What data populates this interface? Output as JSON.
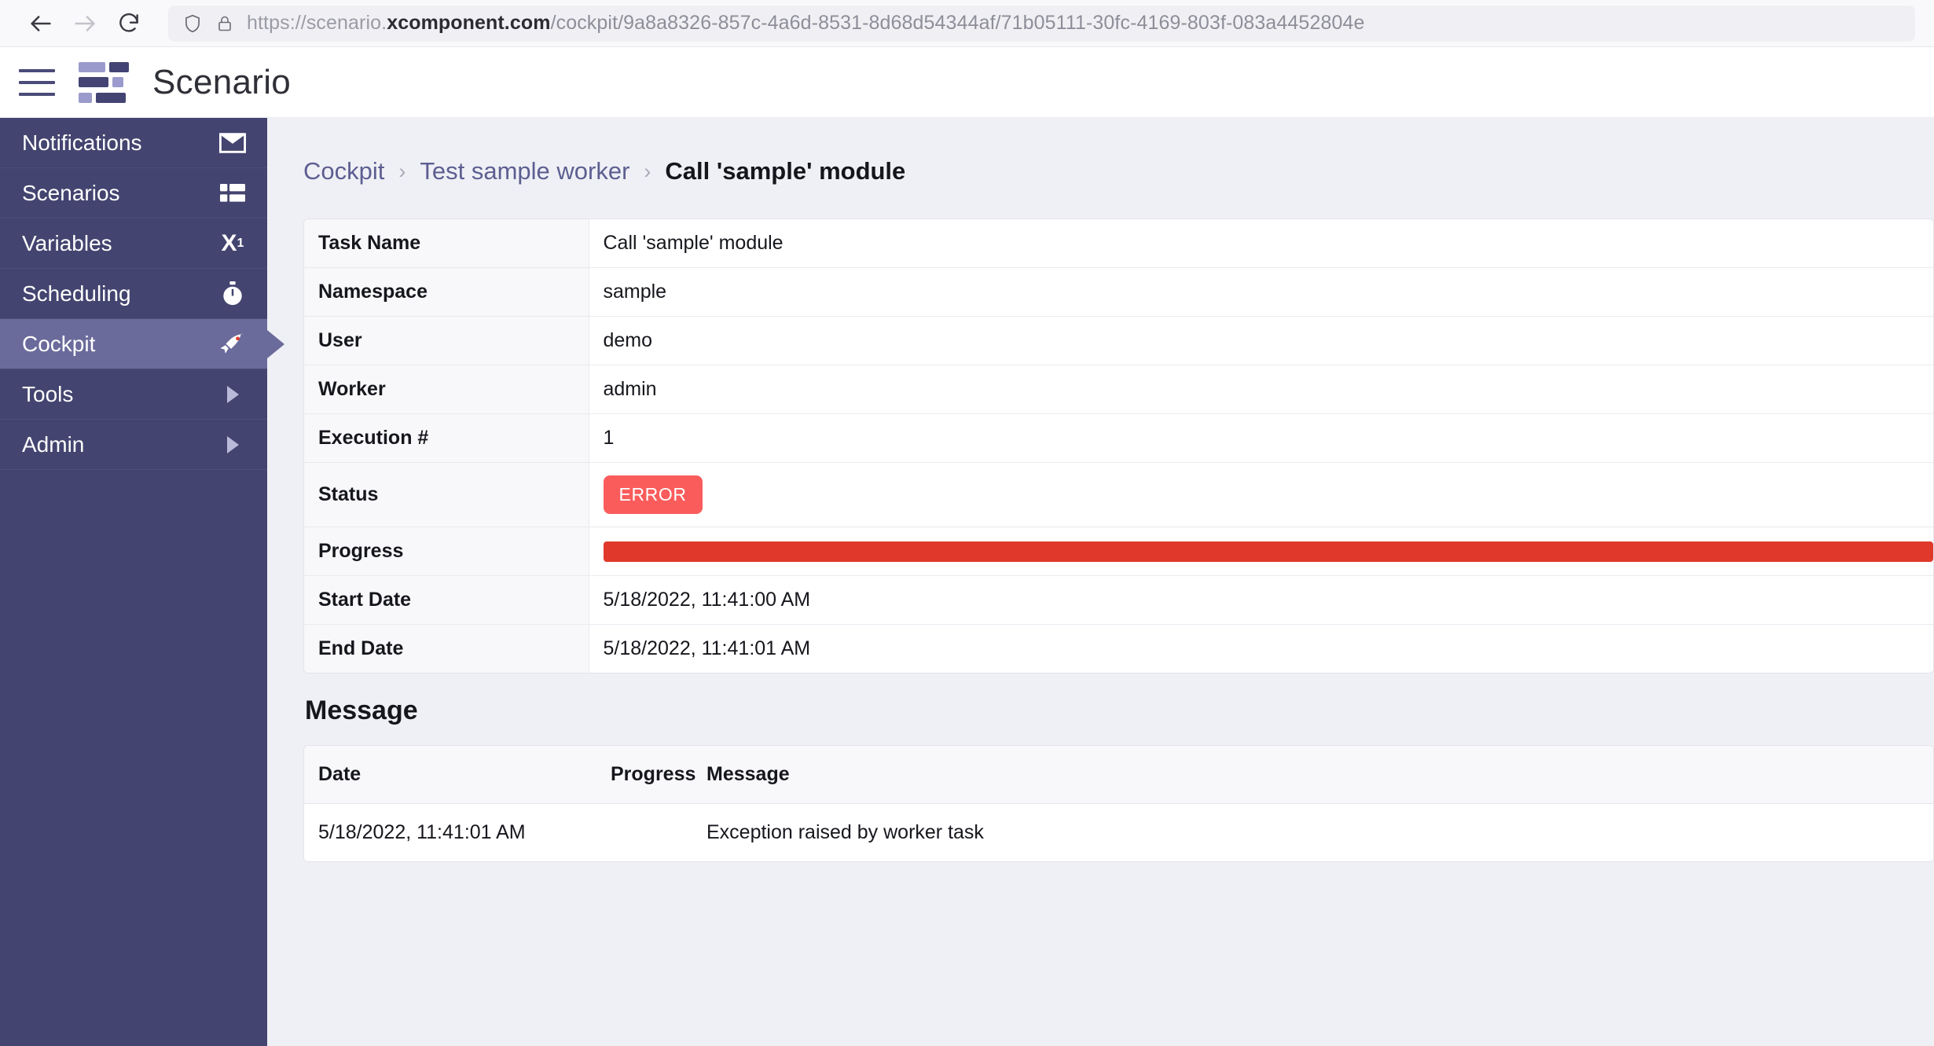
{
  "browser": {
    "back_icon": "arrow-left-icon",
    "forward_icon": "arrow-right-icon",
    "reload_icon": "reload-icon",
    "shield_icon": "shield-icon",
    "lock_icon": "lock-icon",
    "url_scheme": "https://scenario.",
    "url_domain": "xcomponent.com",
    "url_path": "/cockpit/9a8a8326-857c-4a6d-8531-8d68d54344af/71b05111-30fc-4169-803f-083a4452804e",
    "url_full": "https://scenario.xcomponent.com/cockpit/9a8a8326-857c-4a6d-8531-8d68d54344af/71b05111-30fc-4169-803f-083a4452804e"
  },
  "header": {
    "menu_icon": "hamburger-menu-icon",
    "logo_icon": "scenario-logo-icon",
    "title": "Scenario"
  },
  "sidebar": {
    "items": [
      {
        "label": "Notifications",
        "icon": "envelope-icon",
        "active": false,
        "expandable": false
      },
      {
        "label": "Scenarios",
        "icon": "list-table-icon",
        "active": false,
        "expandable": false
      },
      {
        "label": "Variables",
        "icon": "x-superscript-icon",
        "active": false,
        "expandable": false
      },
      {
        "label": "Scheduling",
        "icon": "stopwatch-icon",
        "active": false,
        "expandable": false
      },
      {
        "label": "Cockpit",
        "icon": "rocket-icon",
        "active": true,
        "expandable": false
      },
      {
        "label": "Tools",
        "icon": "caret-right-icon",
        "active": false,
        "expandable": true
      },
      {
        "label": "Admin",
        "icon": "caret-right-icon",
        "active": false,
        "expandable": true
      }
    ],
    "active_color": "#6a6b9b",
    "background_color": "#43446f"
  },
  "breadcrumb": {
    "items": [
      "Cockpit",
      "Test sample worker"
    ],
    "current": "Call 'sample' module",
    "separator": "›"
  },
  "details": {
    "rows": [
      {
        "label": "Task Name",
        "value": "Call 'sample' module",
        "kind": "text"
      },
      {
        "label": "Namespace",
        "value": "sample",
        "kind": "text"
      },
      {
        "label": "User",
        "value": "demo",
        "kind": "text"
      },
      {
        "label": "Worker",
        "value": "admin",
        "kind": "text"
      },
      {
        "label": "Execution #",
        "value": "1",
        "kind": "text"
      },
      {
        "label": "Status",
        "value": "ERROR",
        "kind": "badge"
      },
      {
        "label": "Progress",
        "value": "",
        "kind": "progress"
      },
      {
        "label": "Start Date",
        "value": "5/18/2022, 11:41:00 AM",
        "kind": "text"
      },
      {
        "label": "End Date",
        "value": "5/18/2022, 11:41:01 AM",
        "kind": "text"
      }
    ],
    "status_badge_color": "#fa5c5c",
    "progress_percent": 100,
    "progress_color": "#e0392b"
  },
  "message_section": {
    "title": "Message",
    "columns": [
      "Date",
      "Progress",
      "Message"
    ],
    "rows": [
      {
        "date": "5/18/2022, 11:41:01 AM",
        "progress": "",
        "message": "Exception raised by worker task"
      }
    ]
  }
}
